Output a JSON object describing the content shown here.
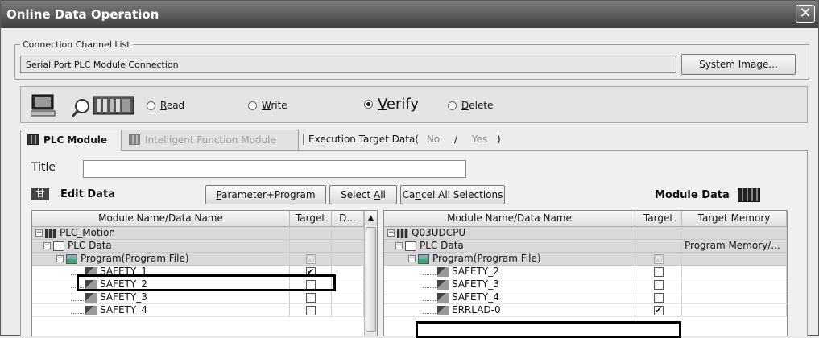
{
  "window": {
    "title": "Online Data Operation",
    "close_glyph": "✕"
  },
  "channel": {
    "legend": "Connection Channel List",
    "value": "Serial Port  PLC Module Connection",
    "system_image_btn": "System Image..."
  },
  "operations": {
    "read": {
      "prefix": "",
      "mnemonic": "R",
      "rest": "ead"
    },
    "write": {
      "prefix": "",
      "mnemonic": "W",
      "rest": "rite"
    },
    "verify": {
      "prefix": "",
      "mnemonic": "V",
      "rest": "erify"
    },
    "delete": {
      "prefix": "",
      "mnemonic": "D",
      "rest": "elete"
    },
    "selected": "verify"
  },
  "tabs": {
    "plc_module": "PLC Module",
    "intelligent": "Intelligent Function Module"
  },
  "exec_target": {
    "label": "Execution Target Data(",
    "no": "No",
    "sep": "/",
    "yes": "Yes",
    "close": ")"
  },
  "title_label": "Title",
  "edit_data": {
    "icon": "甘",
    "label": "Edit Data",
    "param_prog_pre": "",
    "param_prog_mn": "P",
    "param_prog_rest": "arameter+Program",
    "select_all_pre": "Select ",
    "select_all_mn": "A",
    "select_all_rest": "ll",
    "cancel_pre": "Ca",
    "cancel_mn": "n",
    "cancel_rest": "cel All Selections"
  },
  "module_data": {
    "label": "Module Data"
  },
  "left_grid": {
    "headers": [
      "Module Name/Data Name",
      "Target",
      "D..."
    ],
    "rows": [
      {
        "name": "PLC_Motion",
        "target": "",
        "d": ""
      },
      {
        "name": "PLC Data",
        "target": "",
        "d": ""
      },
      {
        "name": "Program(Program File)",
        "target": "☑",
        "d": ""
      },
      {
        "name": "SAFETY_1",
        "target": "✔",
        "d": ""
      },
      {
        "name": "SAFETY_2",
        "target": "",
        "d": ""
      },
      {
        "name": "SAFETY_3",
        "target": "",
        "d": ""
      },
      {
        "name": "SAFETY_4",
        "target": "",
        "d": ""
      }
    ],
    "scroll_up": "▲"
  },
  "right_grid": {
    "headers": [
      "Module Name/Data Name",
      "Target",
      "Target Memory"
    ],
    "rows": [
      {
        "name": "Q03UDCPU",
        "target": "",
        "memory": ""
      },
      {
        "name": "PLC Data",
        "target": "",
        "memory": "Program Memory/..."
      },
      {
        "name": "Program(Program File)",
        "target": "☑",
        "memory": ""
      },
      {
        "name": "SAFETY_2",
        "target": "",
        "memory": ""
      },
      {
        "name": "SAFETY_3",
        "target": "",
        "memory": ""
      },
      {
        "name": "SAFETY_4",
        "target": "",
        "memory": ""
      },
      {
        "name": "ERRLAD-0",
        "target": "✔",
        "memory": ""
      }
    ]
  }
}
